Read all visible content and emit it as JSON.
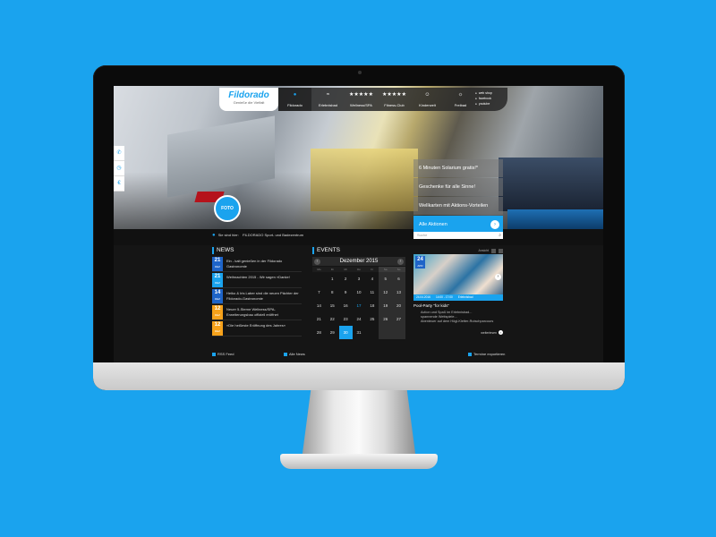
{
  "logo": {
    "name": "Fildorado",
    "tagline": "Genieße die Vielfalt"
  },
  "nav": {
    "items": [
      {
        "label": "Fildorado",
        "icon": "●"
      },
      {
        "label": "Erlebnisbad",
        "icon": "≈"
      },
      {
        "label": "Wellness/SPA",
        "icon": "★★★★★"
      },
      {
        "label": "Fitness-Club",
        "icon": "★★★★★"
      },
      {
        "label": "Kinderwelt",
        "icon": "☺"
      },
      {
        "label": "Freibad",
        "icon": "☼"
      }
    ],
    "social": [
      "web shop",
      "facebook",
      "youtube"
    ]
  },
  "side_tabs": [
    "✆",
    "◷",
    "€"
  ],
  "foto_badge": "FOTO",
  "promos": [
    "6 Minuten Solarium gratis!*",
    "Geschenke für alle Sinne!",
    "Wellkarten mit Aktions-Vorteilen"
  ],
  "promos_all": "Alle Aktionen",
  "search": {
    "placeholder": "Suche"
  },
  "breadcrumb": {
    "prefix": "Sie sind hier:",
    "path": "FILDORADO Sport- und Badezentrum"
  },
  "news": {
    "title": "News",
    "items": [
      {
        "day": "21",
        "month": "DEZ",
        "text": "Ein - kalt genießen in der Fildorado Gastronomie",
        "color": "blue"
      },
      {
        "day": "21",
        "month": "DEZ",
        "text": "Weihnachten 2015 - Wir sagen »Danke!",
        "color": "light"
      },
      {
        "day": "14",
        "month": "DEZ",
        "text": "Heiko & Iris Laber sind die neuen Pächter der Fildorado-Gastronomie",
        "color": "blue"
      },
      {
        "day": "12",
        "month": "DEZ",
        "text": "Neuer 5-Sterne Wellness/SPA-Erweiterungsbau offiziell eröffnet",
        "color": "orange"
      },
      {
        "day": "12",
        "month": "DEZ",
        "text": "»Die heißeste Eröffnung des Jahres«",
        "color": "orange"
      }
    ],
    "rss": "RSS Feed",
    "all": "Alle News"
  },
  "events": {
    "title": "Events",
    "month": "Dezember 2015",
    "dow": [
      "Mo",
      "Di",
      "Mi",
      "Do",
      "Fr",
      "Sa",
      "So"
    ],
    "weeks": [
      [
        "",
        "1",
        "2",
        "3",
        "4",
        "5",
        "6"
      ],
      [
        "7",
        "8",
        "9",
        "10",
        "11",
        "12",
        "13"
      ],
      [
        "14",
        "15",
        "16",
        "17",
        "18",
        "19",
        "20"
      ],
      [
        "21",
        "22",
        "23",
        "24",
        "25",
        "26",
        "27"
      ],
      [
        "28",
        "29",
        "30",
        "31",
        "",
        "",
        ""
      ]
    ],
    "highlight_day": "17",
    "selected_day": "30",
    "export": "Termine exportieren"
  },
  "event_card": {
    "ansicht": "Ansicht",
    "day": "24",
    "month": "APR",
    "meta": [
      "24.04.2016",
      "14:00 - 17:00",
      "Erlebnisbad"
    ],
    "title": "Pool-Party \"for kids\"",
    "desc": [
      "Action und Spaß im Erlebnisbad...",
      "spannende Wettspiele...",
      "Abenteuer auf dem Högl-Kletter-Rutschparcours"
    ],
    "more": "weiterlesen"
  }
}
